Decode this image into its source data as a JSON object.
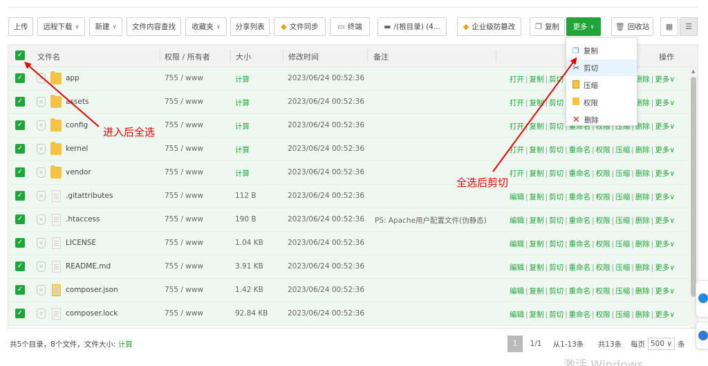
{
  "toolbar": {
    "upload": "上传",
    "remote_download": "远程下载",
    "new": "新建",
    "content_search": "文件内容查找",
    "favorites": "收藏夹",
    "share_list": "分享列表",
    "file_sync": "文件同步",
    "terminal": "终端",
    "path": "/(根目录) (4...",
    "enterprise_tamper": "企业级防篡改",
    "copy": "复制",
    "more": "更多",
    "recycle_bin": "回收站"
  },
  "columns": {
    "name": "文件名",
    "perm_owner": "权限 / 所有者",
    "size": "大小",
    "modified": "修改时间",
    "note": "备注",
    "actions": "操作"
  },
  "rows": [
    {
      "name": "app",
      "type": "folder",
      "perm": "755 / www",
      "size": "计算",
      "time": "2023/06/24 00:52:36",
      "note": "",
      "first_op": "打开"
    },
    {
      "name": "assets",
      "type": "folder",
      "perm": "755 / www",
      "size": "计算",
      "time": "2023/06/24 00:52:36",
      "note": "",
      "first_op": "打开"
    },
    {
      "name": "config",
      "type": "folder",
      "perm": "755 / www",
      "size": "计算",
      "time": "2023/06/24 00:52:36",
      "note": "",
      "first_op": "打开"
    },
    {
      "name": "kernel",
      "type": "folder",
      "perm": "755 / www",
      "size": "计算",
      "time": "2023/06/24 00:52:36",
      "note": "",
      "first_op": "打开"
    },
    {
      "name": "vendor",
      "type": "folder",
      "perm": "755 / www",
      "size": "计算",
      "time": "2023/06/24 00:52:36",
      "note": "",
      "first_op": "打开"
    },
    {
      "name": ".gitattributes",
      "type": "file",
      "perm": "755 / www",
      "size": "112 B",
      "time": "2023/06/24 00:52:36",
      "note": "",
      "first_op": "编辑"
    },
    {
      "name": ".htaccess",
      "type": "file",
      "perm": "755 / www",
      "size": "190 B",
      "time": "2023/06/24 00:52:36",
      "note": "PS: Apache用户配置文件(伪静态)",
      "first_op": "编辑"
    },
    {
      "name": "LICENSE",
      "type": "file",
      "perm": "755 / www",
      "size": "1.04 KB",
      "time": "2023/06/24 00:52:36",
      "note": "",
      "first_op": "编辑"
    },
    {
      "name": "README.md",
      "type": "file",
      "perm": "755 / www",
      "size": "3.91 KB",
      "time": "2023/06/24 00:52:36",
      "note": "",
      "first_op": "编辑"
    },
    {
      "name": "composer.json",
      "type": "json",
      "perm": "755 / www",
      "size": "1.42 KB",
      "time": "2023/06/24 00:52:36",
      "note": "",
      "first_op": "编辑"
    },
    {
      "name": "composer.lock",
      "type": "file",
      "perm": "755 / www",
      "size": "92.84 KB",
      "time": "2023/06/24 00:52:36",
      "note": "",
      "first_op": "编辑"
    }
  ],
  "row_ops": [
    "复制",
    "剪切",
    "重命名",
    "权限",
    "压缩",
    "删除",
    "更多"
  ],
  "more_menu": [
    {
      "label": "复制",
      "icon": "copy-icon"
    },
    {
      "label": "剪切",
      "icon": "scissors-icon"
    },
    {
      "label": "压缩",
      "icon": "archive-icon"
    },
    {
      "label": "权限",
      "icon": "permission-icon"
    },
    {
      "label": "删除",
      "icon": "delete-icon"
    }
  ],
  "annotations": {
    "select_all": "进入后全选",
    "cut_after_select": "全选后剪切"
  },
  "footer": {
    "summary_prefix": "共5个目录，8个文件，文件大小:",
    "summary_calc": "计算",
    "page_current": "1",
    "page_total": "1/1",
    "range": "从1-13条",
    "total": "共13条",
    "per_page_label": "每页",
    "per_page_value": "500",
    "per_page_unit": "条"
  },
  "watermark": "激活 Windows",
  "colors": {
    "accent": "#20a53a",
    "row_selected": "#eef8f0",
    "annotation": "#e60000"
  }
}
